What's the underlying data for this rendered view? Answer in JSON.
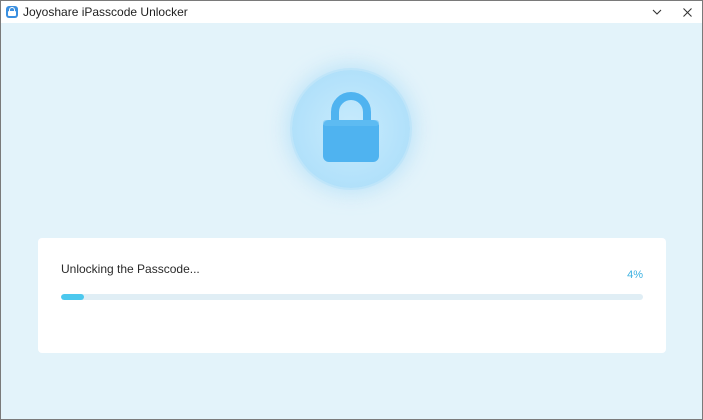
{
  "window": {
    "title": "Joyoshare iPasscode Unlocker",
    "app_icon": "joyoshare-lock-icon",
    "controls": [
      "chevron-down-icon",
      "close-icon"
    ]
  },
  "main": {
    "hero_icon": "padlock-icon",
    "progress": {
      "status_label": "Unlocking the Passcode...",
      "percent_label": "4%",
      "value": 0.04
    }
  },
  "colors": {
    "accent": "#4cc8ee",
    "percent_text": "#3ab0e0",
    "background": "#e3f3fa",
    "lock": "#4fb3f0"
  }
}
